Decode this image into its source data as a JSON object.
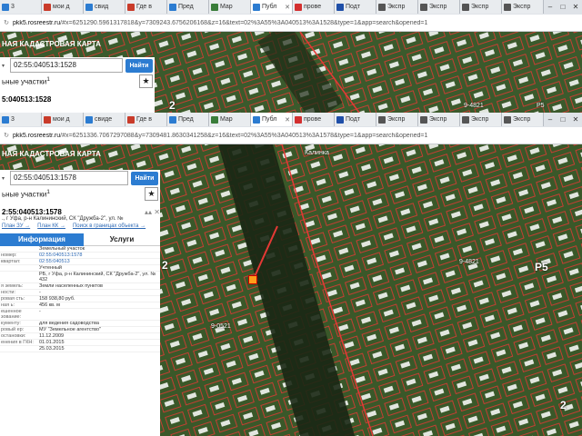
{
  "win1": {
    "tabs": [
      {
        "label": "3",
        "favicon": "#2c7cd1"
      },
      {
        "label": "мои д",
        "favicon": "#c93b2a"
      },
      {
        "label": "свид",
        "favicon": "#2c7cd1"
      },
      {
        "label": "Где в",
        "favicon": "#c93b2a"
      },
      {
        "label": "Пред",
        "favicon": "#2c7cd1"
      },
      {
        "label": "Мар",
        "favicon": "#3a7d3a"
      },
      {
        "label": "Публ",
        "favicon": "#2c7cd1",
        "active": true
      },
      {
        "label": "прове",
        "favicon": "#d32f2f"
      },
      {
        "label": "Подт",
        "favicon": "#1f4fa8"
      },
      {
        "label": "Экспр",
        "favicon": "#555555"
      },
      {
        "label": "Экспр",
        "favicon": "#555555"
      },
      {
        "label": "Экспр",
        "favicon": "#555555"
      },
      {
        "label": "Экспр",
        "favicon": "#555555"
      }
    ],
    "url_host": "pkk5.rosreestr.ru",
    "url_rest": "/#x=6251290.5961317818&y=7309243.6756206168&z=16&text=02%3A55%3A040513%3A1528&type=1&app=search&opened=1",
    "panel_title": "НАЯ КАДАСТРОВАЯ КАРТА",
    "search_value": "02:55:040513:1528",
    "find_label": "Найти",
    "results_label": "ьные участки",
    "results_sup": "1",
    "obj_number": "5:040513:1528"
  },
  "win2": {
    "tabs": [
      {
        "label": "3",
        "favicon": "#2c7cd1"
      },
      {
        "label": "мои д",
        "favicon": "#c93b2a"
      },
      {
        "label": "свиде",
        "favicon": "#2c7cd1"
      },
      {
        "label": "Где в",
        "favicon": "#c93b2a"
      },
      {
        "label": "Пред",
        "favicon": "#2c7cd1"
      },
      {
        "label": "Мар",
        "favicon": "#3a7d3a"
      },
      {
        "label": "Публ",
        "favicon": "#2c7cd1",
        "active": true
      },
      {
        "label": "прове",
        "favicon": "#d32f2f"
      },
      {
        "label": "Подт",
        "favicon": "#1f4fa8"
      },
      {
        "label": "Экспр",
        "favicon": "#555555"
      },
      {
        "label": "Экспр",
        "favicon": "#555555"
      },
      {
        "label": "Экспр",
        "favicon": "#555555"
      },
      {
        "label": "Экспр",
        "favicon": "#555555"
      }
    ],
    "url_host": "pkk5.rosreestr.ru",
    "url_rest": "/#x=6251336.7067297088&y=7309481.8630341258&z=16&text=02%3A55%3A040513%3A1578&type=1&app=search&opened=1",
    "panel_title": "НАЯ КАДАСТРОВАЯ КАРТА",
    "search_value": "02:55:040513:1578",
    "find_label": "Найти",
    "results_label": "ьные участки",
    "results_sup": "1",
    "obj_number": "2:55:040513:1578",
    "obj_address": "., г Уфа, р-н Калининский, СК \"Дружба-2\", ул. №",
    "links": [
      "План ЗУ →",
      "План КК →",
      "Поиск в границах объекта →"
    ],
    "tab_info": "Информация",
    "tab_services": "Услуги",
    "attrs": [
      {
        "k": "",
        "v": "Земельный участок",
        "link": false
      },
      {
        "k": "номер:",
        "v": "02:55:040513:1578",
        "link": true
      },
      {
        "k": "квартал:",
        "v": "02:55:040513",
        "link": true
      },
      {
        "k": "",
        "v": "Учтенный",
        "link": false
      },
      {
        "k": "",
        "v": "РБ, г Уфа, р-н Калининский, СК \"Дружба-2\", ул. № 432",
        "link": false
      },
      {
        "k": "я земель:",
        "v": "Земли населенных пунктов",
        "link": false
      },
      {
        "k": "ности:",
        "v": "-",
        "link": false
      },
      {
        "k": "ровая сть:",
        "v": "158 938,80 руб.",
        "link": false
      },
      {
        "k": "ная ь:",
        "v": "456 кв. м",
        "link": false
      },
      {
        "k": "ешенное зование:",
        "v": "-",
        "link": false
      },
      {
        "k": "кументу:",
        "v": "для ведения садоводства",
        "link": false
      },
      {
        "k": "ровый ер:",
        "v": "МУ \"Земельное агентство\"",
        "link": false
      },
      {
        "k": "остановки:",
        "v": "11.12.2009",
        "link": false
      },
      {
        "k": "енения в ГКН:",
        "v": "01.01.2015",
        "link": false
      },
      {
        "k": "",
        "v": "25.03.2015",
        "link": false
      }
    ],
    "map_labels": [
      "2",
      "9-4821",
      "Р5",
      "9-0521",
      "2",
      "Калинка"
    ]
  },
  "win1_map_labels": [
    "2",
    "9-4821",
    "Р5"
  ]
}
